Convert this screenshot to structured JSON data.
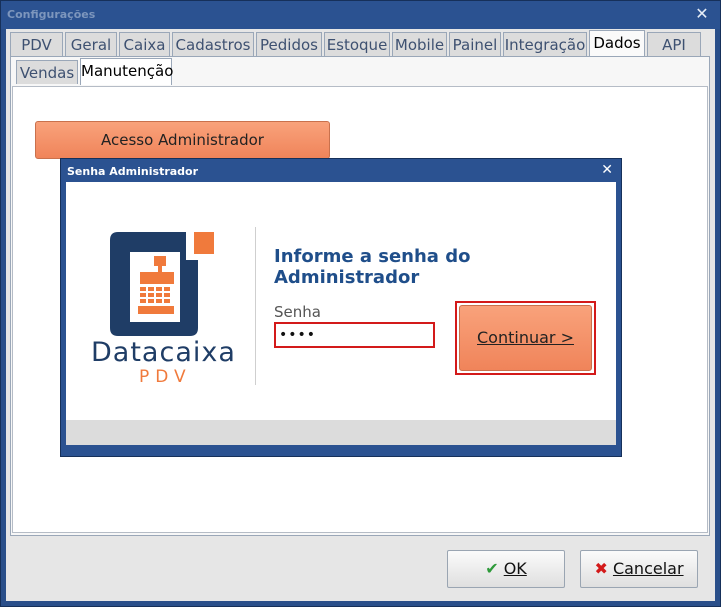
{
  "window": {
    "title": "Configurações"
  },
  "tabs": [
    {
      "label": "PDV"
    },
    {
      "label": "Geral"
    },
    {
      "label": "Caixa"
    },
    {
      "label": "Cadastros"
    },
    {
      "label": "Pedidos"
    },
    {
      "label": "Estoque"
    },
    {
      "label": "Mobile"
    },
    {
      "label": "Painel"
    },
    {
      "label": "Integração"
    },
    {
      "label": "Dados",
      "active": true
    },
    {
      "label": "API"
    }
  ],
  "subtabs": [
    {
      "label": "Vendas"
    },
    {
      "label": "Manutenção",
      "active": true
    }
  ],
  "admin_access_button": "Acesso Administrador",
  "modal": {
    "title": "Senha Administrador",
    "heading": "Informe a senha do Administrador",
    "password_label": "Senha",
    "password_value": "••••",
    "continue_button": "Continuar >"
  },
  "logo": {
    "brand": "Datacaixa",
    "sub": "PDV"
  },
  "footer": {
    "ok_label": "OK",
    "cancel_label": "Cancelar"
  },
  "colors": {
    "accent_orange": "#f0845a",
    "title_blue": "#1f4e8a",
    "frame_blue": "#2b5291",
    "highlight_red": "#d31a1a"
  }
}
